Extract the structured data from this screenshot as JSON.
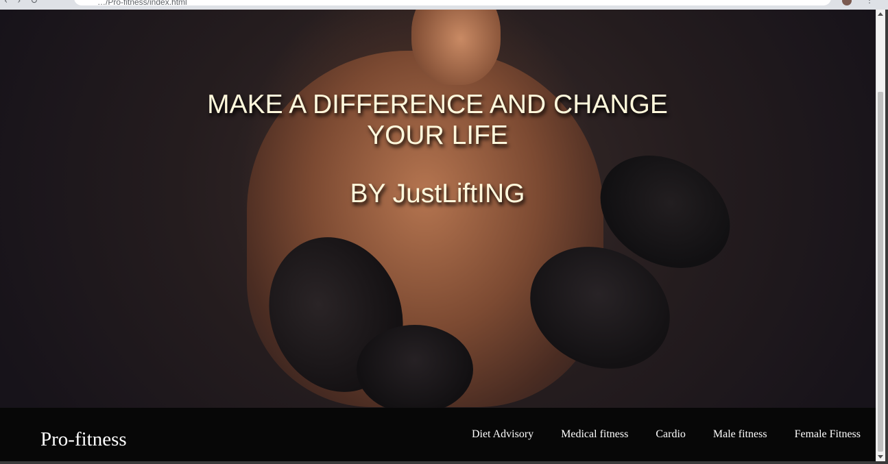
{
  "browser": {
    "url": "…/Pro-fitness/index.html",
    "icons": [
      "back-icon",
      "forward-icon",
      "reload-icon",
      "extension-icon",
      "menu-icon"
    ]
  },
  "hero": {
    "title": "MAKE A DIFFERENCE AND CHANGE YOUR LIFE",
    "subtitle": "BY JustLiftING",
    "text_color": "#fff8dc"
  },
  "navbar": {
    "brand": "Pro-fitness",
    "links": [
      {
        "label": "Diet Advisory"
      },
      {
        "label": "Medical fitness"
      },
      {
        "label": "Cardio"
      },
      {
        "label": "Male fitness"
      },
      {
        "label": "Female Fitness"
      }
    ],
    "background": "#070707"
  }
}
